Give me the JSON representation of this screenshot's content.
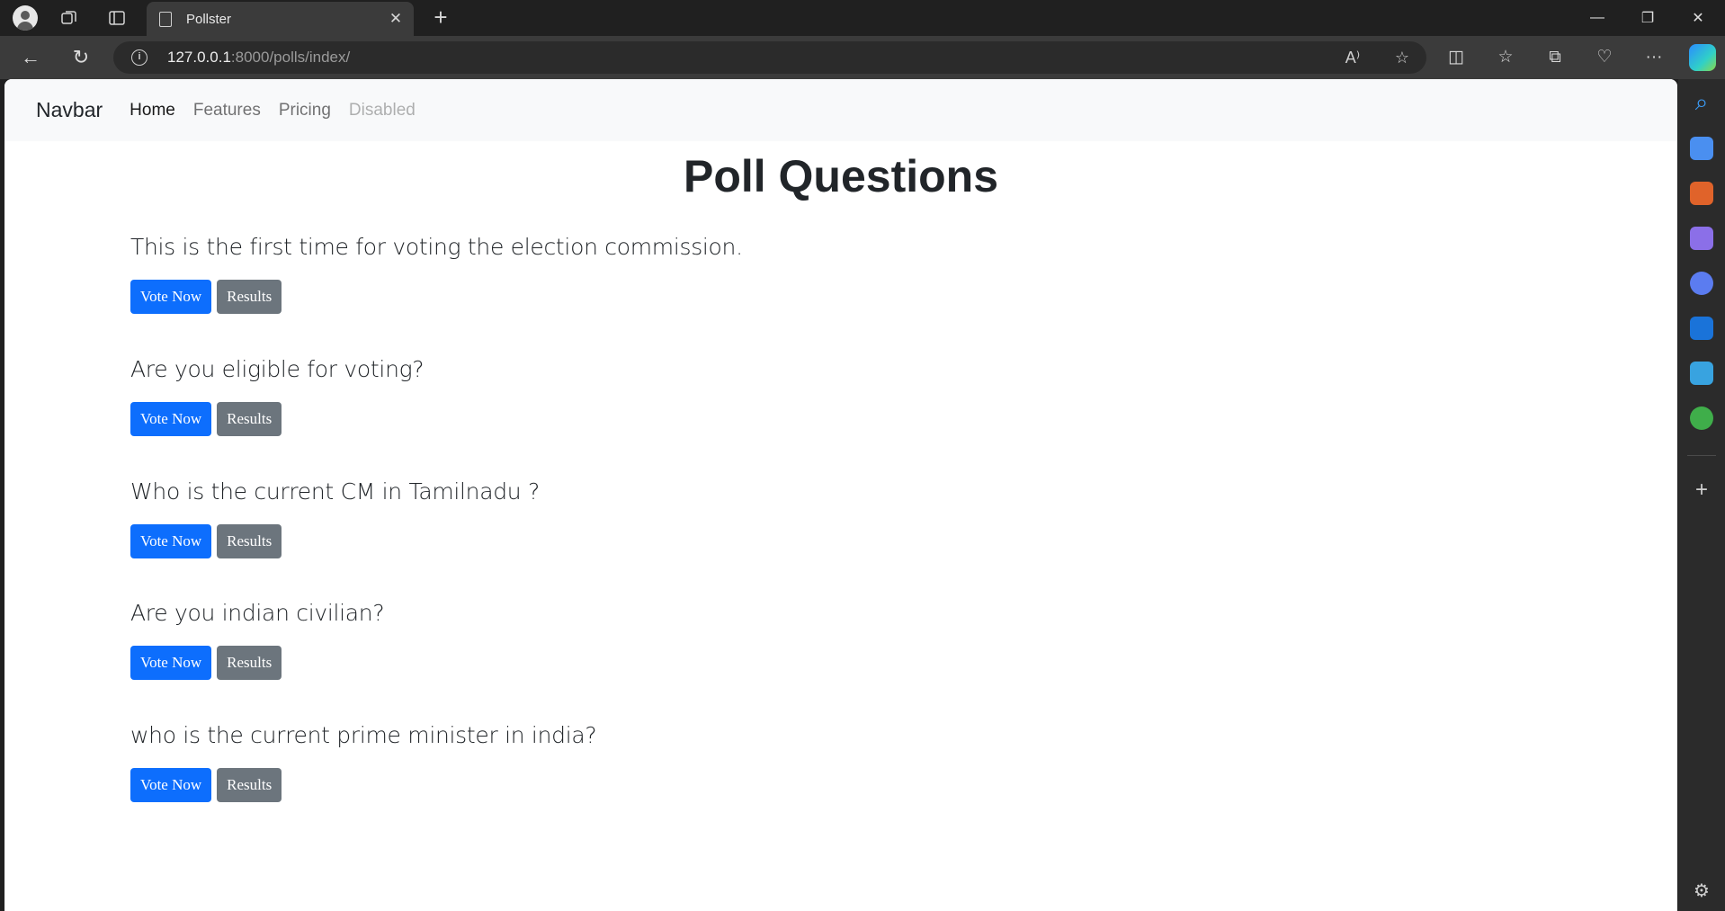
{
  "browser": {
    "tab_title": "Pollster",
    "url_host": "127.0.0.1",
    "url_path": ":8000/polls/index/",
    "tab_close_glyph": "✕",
    "new_tab_glyph": "+",
    "window_controls": {
      "minimize": "—",
      "restore": "❐",
      "close": "✕"
    },
    "nav": {
      "back": "←",
      "refresh": "↻"
    },
    "omnibox_icons": {
      "info": "i",
      "read_aloud": "A⁾",
      "favorite": "☆"
    },
    "toolbar_icons": [
      "split-screen-icon",
      "favorites-icon",
      "collections-icon",
      "browser-essentials-icon",
      "more-icon"
    ],
    "toolbar_glyphs": {
      "split": "◫",
      "favorites": "☆",
      "collections": "⧉",
      "essentials": "♡",
      "more": "···"
    },
    "sidebar_icons": [
      {
        "name": "search-icon",
        "color": "#3b9bf5"
      },
      {
        "name": "shopping-tag-icon",
        "color": "#4a8ff0"
      },
      {
        "name": "tools-icon",
        "color": "#e0632a"
      },
      {
        "name": "games-icon",
        "color": "#8b6fe8"
      },
      {
        "name": "copilot-app-icon",
        "color": "#5b7cf0"
      },
      {
        "name": "outlook-icon",
        "color": "#1a73d9"
      },
      {
        "name": "send-icon",
        "color": "#38a3e0"
      },
      {
        "name": "tree-icon",
        "color": "#3fae4a"
      }
    ],
    "sidebar_glyphs": {
      "search": "⌕",
      "add": "+",
      "settings": "⚙"
    }
  },
  "navbar": {
    "brand": "Navbar",
    "links": [
      {
        "label": "Home",
        "state": "active"
      },
      {
        "label": "Features",
        "state": "normal"
      },
      {
        "label": "Pricing",
        "state": "normal"
      },
      {
        "label": "Disabled",
        "state": "disabled"
      }
    ]
  },
  "page": {
    "title": "Poll Questions",
    "vote_label": "Vote Now",
    "results_label": "Results",
    "questions": [
      {
        "text": "This is the first time for voting the election commission."
      },
      {
        "text": "Are you eligible for voting?"
      },
      {
        "text": "Who is the current CM in Tamilnadu ?"
      },
      {
        "text": "Are you indian civilian?"
      },
      {
        "text": "who is the current prime minister in india?"
      }
    ]
  },
  "colors": {
    "primary": "#0d6efd",
    "secondary": "#6c757d",
    "navbar_bg": "#f8f9fa",
    "browser_chrome": "#202020"
  }
}
